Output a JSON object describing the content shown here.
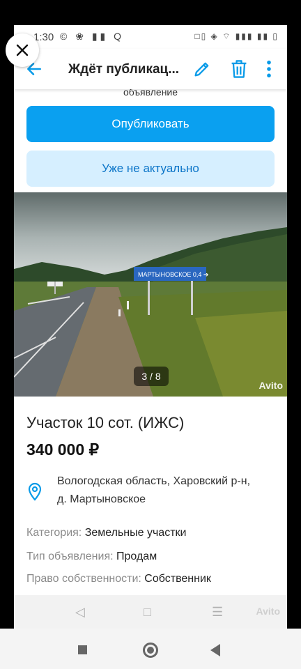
{
  "status_bar": {
    "time": "1:30",
    "left_icons": "© ❀ ▮▮ Q",
    "right_icons": "□▯ ◈ ⌔ ▮▮▮ ▮▮ ▯"
  },
  "app_bar": {
    "title": "Ждёт публикац..."
  },
  "partial_text": "объявление",
  "actions": {
    "publish": "Опубликовать",
    "not_actual": "Уже не актуально"
  },
  "photo": {
    "counter": "3 / 8",
    "watermark": "Avito",
    "sign_text": "МАРТЫНОВСКОЕ 0,4 ➔"
  },
  "listing": {
    "title": "Участок 10 сот. (ИЖС)",
    "price": "340 000 ₽"
  },
  "address": {
    "line1": "Вологодская область, Харовский р-н,",
    "line2": "д. Мартыновское"
  },
  "params": [
    {
      "key": "Категория: ",
      "value": "Земельные участки"
    },
    {
      "key": "Тип объявления: ",
      "value": "Продам"
    },
    {
      "key": "Право собственности: ",
      "value": "Собственник"
    }
  ],
  "nav": {
    "back": "◁",
    "home": "□",
    "menu": "☰",
    "watermark": "Avito"
  },
  "colors": {
    "accent": "#0aa0f0",
    "secondary_bg": "#d6efff",
    "secondary_text": "#0a74c8"
  }
}
